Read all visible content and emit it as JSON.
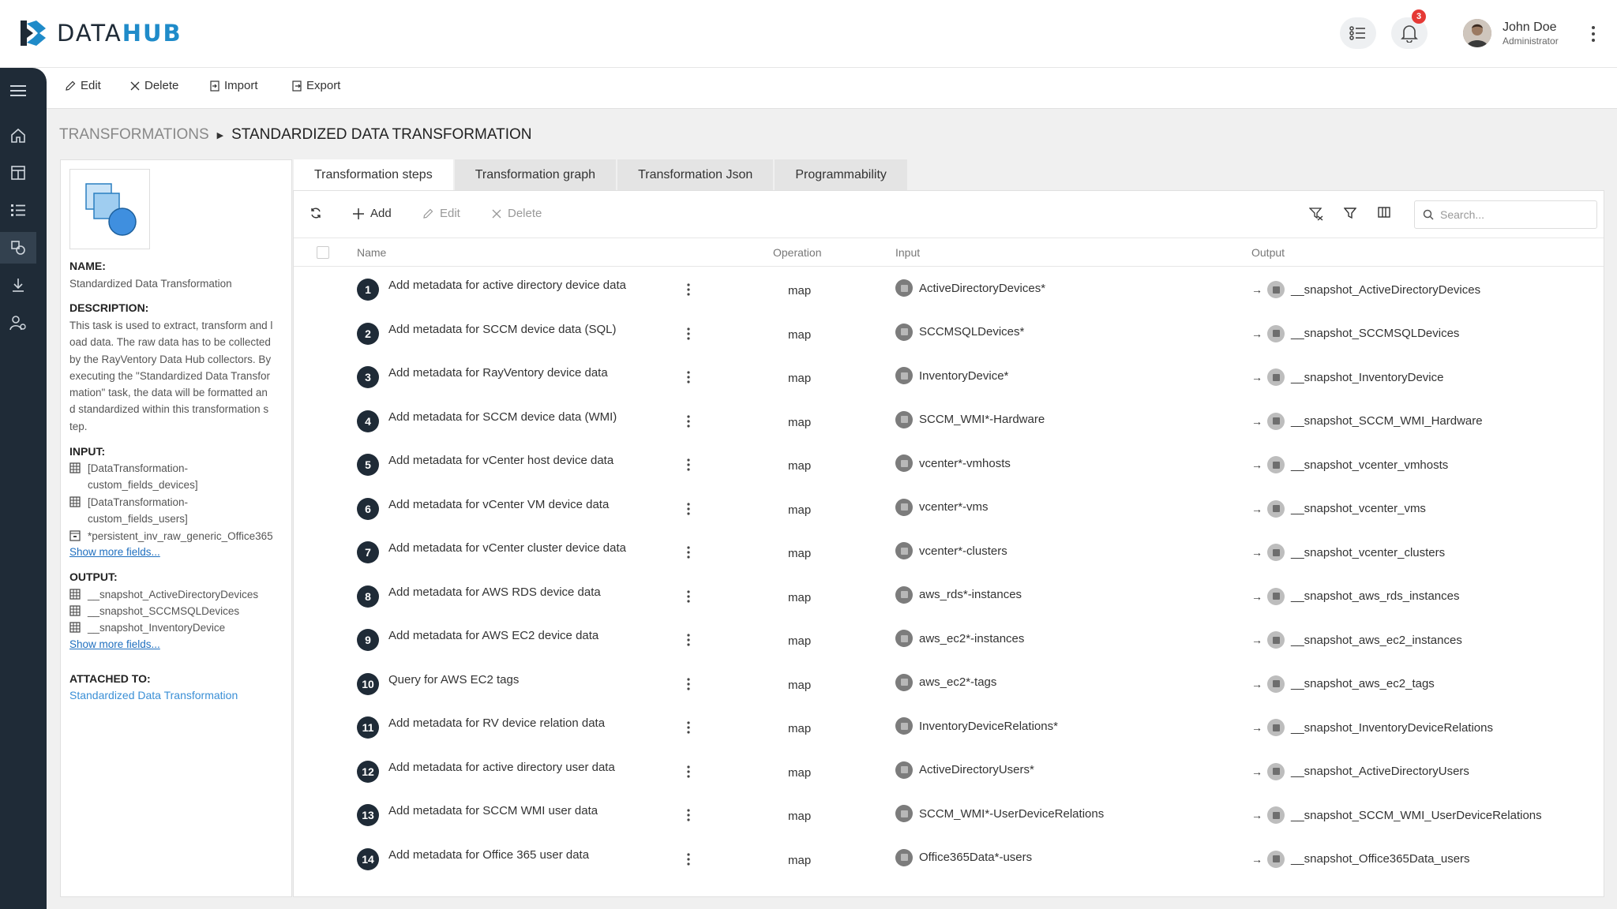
{
  "app": {
    "logo_data": "DATA",
    "logo_hub": "HUB"
  },
  "header": {
    "notification_count": "3",
    "user_name": "John Doe",
    "user_role": "Administrator"
  },
  "toolbar": {
    "edit": "Edit",
    "delete": "Delete",
    "import": "Import",
    "export": "Export"
  },
  "breadcrumb": {
    "root": "TRANSFORMATIONS",
    "current": "STANDARDIZED DATA TRANSFORMATION"
  },
  "details": {
    "name_label": "NAME:",
    "name_value": "Standardized Data Transformation",
    "description_label": "DESCRIPTION:",
    "description_lines": [
      "This task is used to extract, transform and l",
      "oad data. The raw data has to be collected",
      "by the RayVentory Data Hub collectors. By",
      "executing the \"Standardized Data Transfor",
      "mation\" task, the data will be formatted an",
      "d standardized within this transformation s",
      "tep."
    ],
    "input_label": "INPUT:",
    "input_items": [
      "[DataTransformation-custom_fields_devices]",
      "[DataTransformation-custom_fields_users]",
      "*persistent_inv_raw_generic_Office365"
    ],
    "show_more": "Show more fields...",
    "output_label": "OUTPUT:",
    "output_items": [
      "__snapshot_ActiveDirectoryDevices",
      "__snapshot_SCCMSQLDevices",
      "__snapshot_InventoryDevice"
    ],
    "show_more_output": "Show more fields...",
    "attached_label": "ATTACHED TO:",
    "attached_value": "Standardized Data Transformation"
  },
  "tabs": [
    "Transformation steps",
    "Transformation graph",
    "Transformation Json",
    "Programmability"
  ],
  "grid_toolbar": {
    "add": "Add",
    "edit": "Edit",
    "delete": "Delete",
    "search_placeholder": "Search..."
  },
  "columns": {
    "name": "Name",
    "operation": "Operation",
    "input": "Input",
    "output": "Output"
  },
  "rows": [
    {
      "num": "1",
      "name": "Add metadata for active directory device data",
      "op": "map",
      "input": "ActiveDirectoryDevices*",
      "output": "__snapshot_ActiveDirectoryDevices"
    },
    {
      "num": "2",
      "name": "Add metadata for SCCM device data (SQL)",
      "op": "map",
      "input": "SCCMSQLDevices*",
      "output": "__snapshot_SCCMSQLDevices"
    },
    {
      "num": "3",
      "name": "Add metadata for RayVentory device data",
      "op": "map",
      "input": "InventoryDevice*",
      "output": "__snapshot_InventoryDevice"
    },
    {
      "num": "4",
      "name": "Add metadata for SCCM device data (WMI)",
      "op": "map",
      "input": "SCCM_WMI*-Hardware",
      "output": "__snapshot_SCCM_WMI_Hardware"
    },
    {
      "num": "5",
      "name": "Add metadata for vCenter host device data",
      "op": "map",
      "input": "vcenter*-vmhosts",
      "output": "__snapshot_vcenter_vmhosts"
    },
    {
      "num": "6",
      "name": "Add metadata for vCenter VM device data",
      "op": "map",
      "input": "vcenter*-vms",
      "output": "__snapshot_vcenter_vms"
    },
    {
      "num": "7",
      "name": "Add metadata for vCenter cluster device data",
      "op": "map",
      "input": "vcenter*-clusters",
      "output": "__snapshot_vcenter_clusters"
    },
    {
      "num": "8",
      "name": "Add metadata for AWS RDS device data",
      "op": "map",
      "input": "aws_rds*-instances",
      "output": "__snapshot_aws_rds_instances"
    },
    {
      "num": "9",
      "name": "Add metadata for AWS EC2 device data",
      "op": "map",
      "input": "aws_ec2*-instances",
      "output": "__snapshot_aws_ec2_instances"
    },
    {
      "num": "10",
      "name": "Query for AWS EC2 tags",
      "op": "map",
      "input": "aws_ec2*-tags",
      "output": "__snapshot_aws_ec2_tags"
    },
    {
      "num": "11",
      "name": "Add metadata for RV device relation data",
      "op": "map",
      "input": "InventoryDeviceRelations*",
      "output": "__snapshot_InventoryDeviceRelations"
    },
    {
      "num": "12",
      "name": "Add metadata for active directory user data",
      "op": "map",
      "input": "ActiveDirectoryUsers*",
      "output": "__snapshot_ActiveDirectoryUsers"
    },
    {
      "num": "13",
      "name": "Add metadata for SCCM WMI user data",
      "op": "map",
      "input": "SCCM_WMI*-UserDeviceRelations",
      "output": "__snapshot_SCCM_WMI_UserDeviceRelations"
    },
    {
      "num": "14",
      "name": "Add metadata for Office 365 user data",
      "op": "map",
      "input": "Office365Data*-users",
      "output": "__snapshot_Office365Data_users"
    }
  ],
  "colors": {
    "sidebar": "#1f2b37",
    "accent": "#1f8bc9",
    "badge": "#e53935",
    "link": "#1f6fbf"
  }
}
